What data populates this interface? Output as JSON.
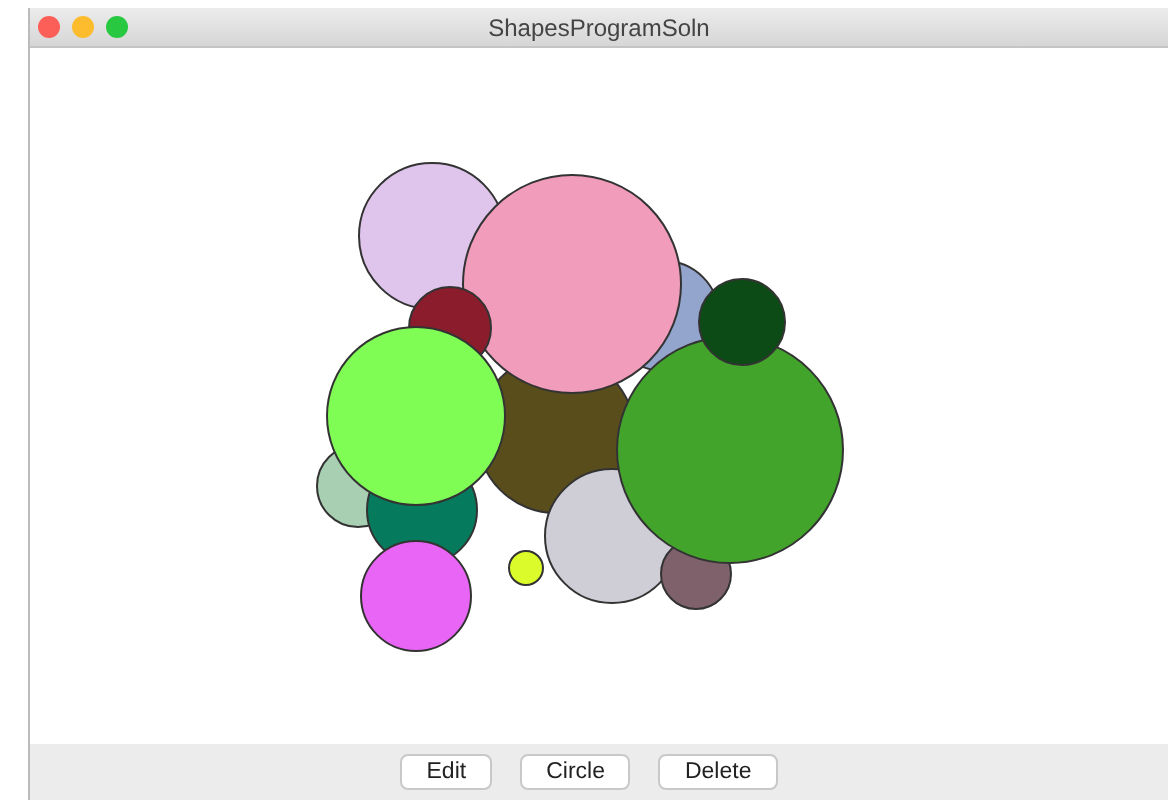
{
  "window": {
    "title": "ShapesProgramSoln"
  },
  "canvas": {
    "circles": [
      {
        "color": "#5a4d1c"
      },
      {
        "color": "#dfc4ec"
      },
      {
        "color": "#93a5cc"
      },
      {
        "color": "#f19cba"
      },
      {
        "color": "#8b1c2c"
      },
      {
        "color": "#a9cfb3"
      },
      {
        "color": "#067a5c"
      },
      {
        "color": "#80fd55"
      },
      {
        "color": "#cfcdd6"
      },
      {
        "color": "#7e616b"
      },
      {
        "color": "#42a42b"
      },
      {
        "color": "#0d4b16"
      },
      {
        "color": "#e965f5"
      },
      {
        "color": "#dcfb2a"
      }
    ]
  },
  "buttons": [
    {
      "label": "Edit"
    },
    {
      "label": "Circle"
    },
    {
      "label": "Delete"
    }
  ]
}
